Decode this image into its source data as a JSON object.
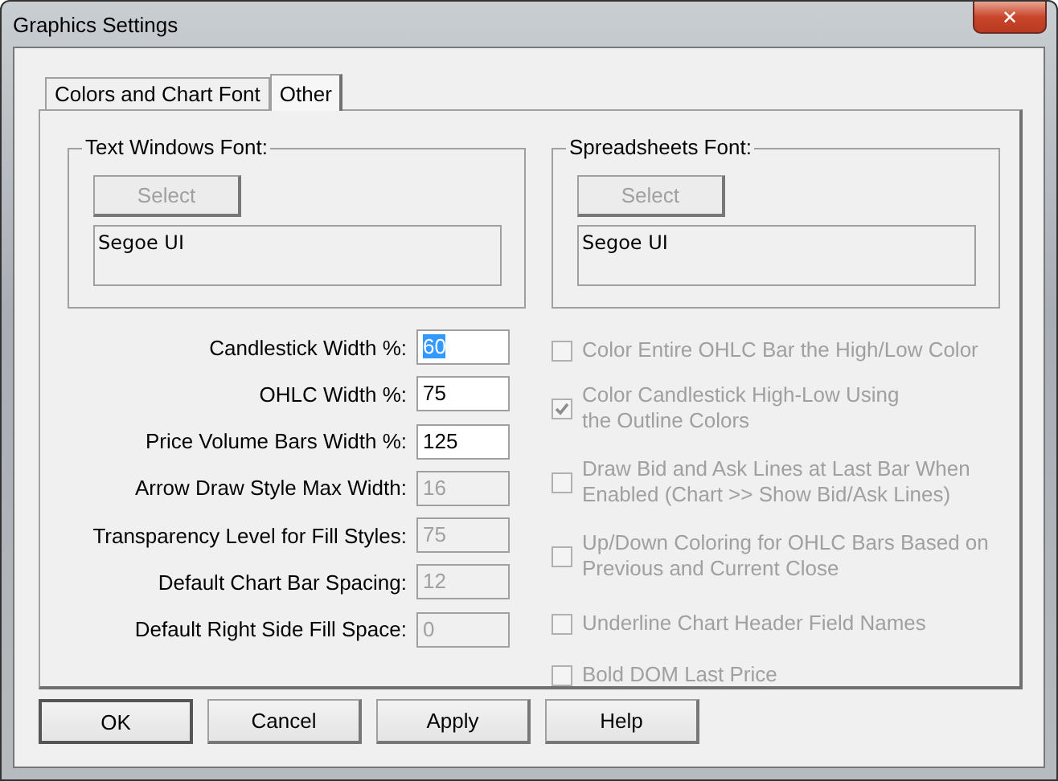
{
  "window": {
    "title": "Graphics Settings",
    "close": "✕"
  },
  "tabs": [
    {
      "label": "Colors and Chart Font",
      "selected": false
    },
    {
      "label": "Other",
      "selected": true
    }
  ],
  "font_groups": [
    {
      "title": "Text Windows Font:",
      "button": "Select",
      "button_disabled": true,
      "sample": "Segoe UI"
    },
    {
      "title": "Spreadsheets Font:",
      "button": "Select",
      "button_disabled": true,
      "sample": "Segoe UI"
    }
  ],
  "fields": [
    {
      "label": "Candlestick Width %:",
      "value": "60",
      "text_selected": true,
      "disabled": false
    },
    {
      "label": "OHLC Width %:",
      "value": "75",
      "text_selected": false,
      "disabled": false
    },
    {
      "label": "Price Volume Bars Width %:",
      "value": "125",
      "text_selected": false,
      "disabled": false
    },
    {
      "label": "Arrow Draw Style Max Width:",
      "value": "16",
      "text_selected": false,
      "disabled": true
    },
    {
      "label": "Transparency Level for Fill Styles:",
      "value": "75",
      "text_selected": false,
      "disabled": true
    },
    {
      "label": "Default Chart Bar Spacing:",
      "value": "12",
      "text_selected": false,
      "disabled": true
    },
    {
      "label": "Default Right Side Fill Space:",
      "value": "0",
      "text_selected": false,
      "disabled": true
    }
  ],
  "checkboxes": [
    {
      "lines": [
        "Color Entire OHLC Bar the High/Low Color"
      ],
      "checked": false,
      "disabled": true
    },
    {
      "lines": [
        "Color Candlestick High-Low Using",
        "the Outline Colors"
      ],
      "checked": true,
      "disabled": true
    },
    {
      "lines": [
        "Draw Bid and Ask Lines at Last Bar When",
        "Enabled (Chart >> Show Bid/Ask Lines)"
      ],
      "checked": false,
      "disabled": true
    },
    {
      "lines": [
        "Up/Down Coloring for OHLC Bars Based on",
        "Previous and Current Close"
      ],
      "checked": false,
      "disabled": true
    },
    {
      "lines": [
        "Underline Chart Header Field Names"
      ],
      "checked": false,
      "disabled": true
    },
    {
      "lines": [
        "Bold DOM Last Price"
      ],
      "checked": false,
      "disabled": true
    }
  ],
  "buttons": [
    {
      "label": "OK",
      "default": true
    },
    {
      "label": "Cancel",
      "default": false
    },
    {
      "label": "Apply",
      "default": false
    },
    {
      "label": "Help",
      "default": false
    }
  ]
}
